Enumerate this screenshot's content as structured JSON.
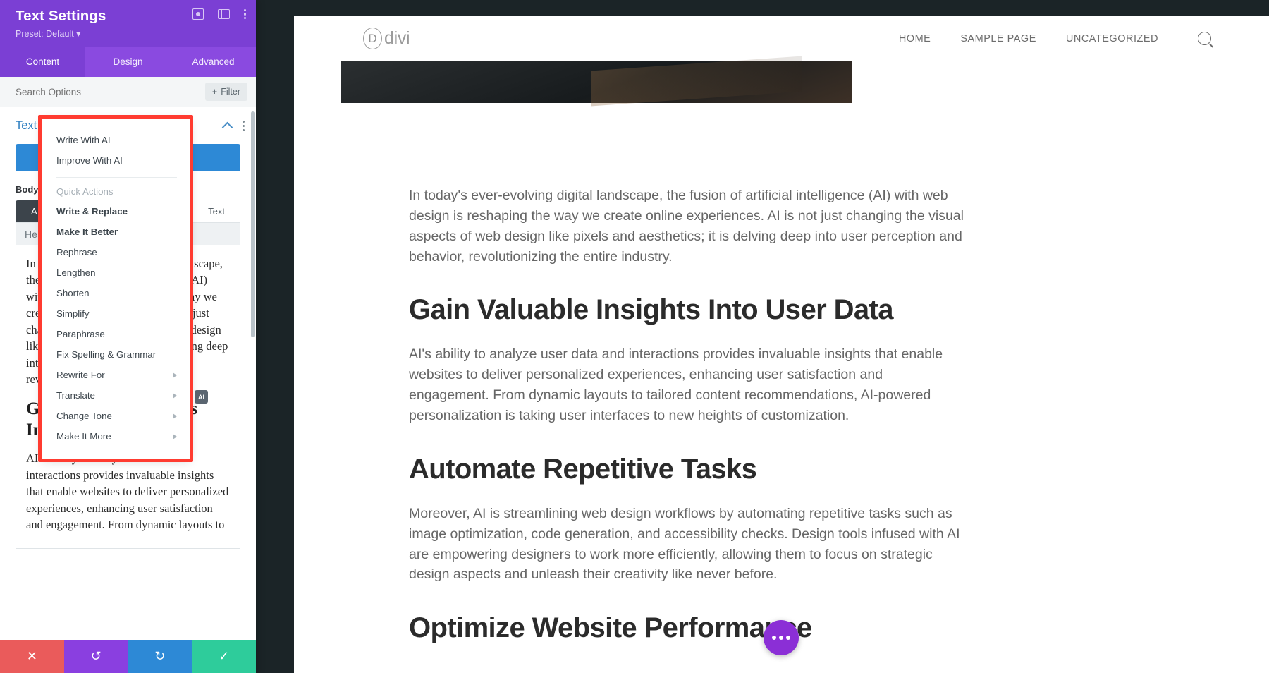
{
  "panel": {
    "title": "Text Settings",
    "preset": "Preset: Default",
    "preset_caret": "▾",
    "icons": {
      "focus": "focus-mode-icon",
      "layout": "layout-icon",
      "kebab": "more-options-icon"
    },
    "tabs": [
      {
        "label": "Content",
        "active": true
      },
      {
        "label": "Design",
        "active": false
      },
      {
        "label": "Advanced",
        "active": false
      }
    ],
    "search": {
      "placeholder": "Search Options",
      "value": ""
    },
    "filter_label": "Filter",
    "filter_plus": "+",
    "section": {
      "title": "Text"
    },
    "body_label": "Body",
    "editor_tabs": [
      {
        "label": "A",
        "active": true
      },
      {
        "label": "Text",
        "active": false
      }
    ],
    "toolbar_items": [
      "He",
      "¶",
      "“",
      "▾",
      "➦"
    ],
    "editor_paragraph_1": "In today's ever-evolving digital landscape, the fusion of artificial intelligence (AI) with web design is reshaping the way we create online experiences. AI is not just changing the visual aspects of web design like pixels and aesthetics; it is delving deep into user perception and behavior, revolutionizing the entire industry.",
    "editor_heading_1": "Gain Valuable Insights Into User Data",
    "editor_paragraph_2": "AI's ability to analyze user data and interactions provides invaluable insights that enable websites to deliver personalized experiences, enhancing user satisfaction and engagement. From dynamic layouts to",
    "ai_badge_label": "AI",
    "footer": [
      {
        "name": "cancel",
        "glyph": "✕"
      },
      {
        "name": "undo",
        "glyph": "↺"
      },
      {
        "name": "redo",
        "glyph": "↻"
      },
      {
        "name": "save",
        "glyph": "✓"
      }
    ]
  },
  "ai_menu": {
    "primary": [
      "Write With AI",
      "Improve With AI"
    ],
    "group_label": "Quick Actions",
    "actions": [
      {
        "label": "Write & Replace",
        "submenu": false
      },
      {
        "label": "Make It Better",
        "submenu": false
      },
      {
        "label": "Rephrase",
        "submenu": false
      },
      {
        "label": "Lengthen",
        "submenu": false
      },
      {
        "label": "Shorten",
        "submenu": false
      },
      {
        "label": "Simplify",
        "submenu": false
      },
      {
        "label": "Paraphrase",
        "submenu": false
      },
      {
        "label": "Fix Spelling & Grammar",
        "submenu": false
      },
      {
        "label": "Rewrite For",
        "submenu": true
      },
      {
        "label": "Translate",
        "submenu": true
      },
      {
        "label": "Change Tone",
        "submenu": true
      },
      {
        "label": "Make It More",
        "submenu": true
      }
    ],
    "highlight_color": "#ff3b30"
  },
  "site": {
    "logo_mark": "D",
    "logo_text": "divi",
    "nav": [
      "HOME",
      "SAMPLE PAGE",
      "UNCATEGORIZED"
    ],
    "search_icon": "search-icon",
    "paragraph_1": "In today's ever-evolving digital landscape, the fusion of artificial intelligence (AI) with web design is reshaping the way we create online experiences. AI is not just changing the visual aspects of web design like pixels and aesthetics; it is delving deep into user perception and behavior, revolutionizing the entire industry.",
    "heading_1": "Gain Valuable Insights Into User Data",
    "paragraph_2": "AI's ability to analyze user data and interactions provides invaluable insights that enable websites to deliver personalized experiences, enhancing user satisfaction and engagement. From dynamic layouts to tailored content recommendations, AI-powered personalization is taking user interfaces to new heights of customization.",
    "heading_2": "Automate Repetitive Tasks",
    "paragraph_3": "Moreover, AI is streamlining web design workflows by automating repetitive tasks such as image optimization, code generation, and accessibility checks. Design tools infused with AI are empowering designers to work more efficiently, allowing them to focus on strategic design aspects and unleash their creativity like never before.",
    "heading_3": "Optimize Website Performance"
  },
  "colors": {
    "panel_header": "#7b3fd4",
    "panel_tabs": "#8a4ae0",
    "accent_blue": "#2d89d6",
    "cancel_red": "#ea5b5b",
    "save_green": "#2ecc9b",
    "highlight_red": "#ff3b30",
    "chat_purple": "#8b2fd6"
  }
}
